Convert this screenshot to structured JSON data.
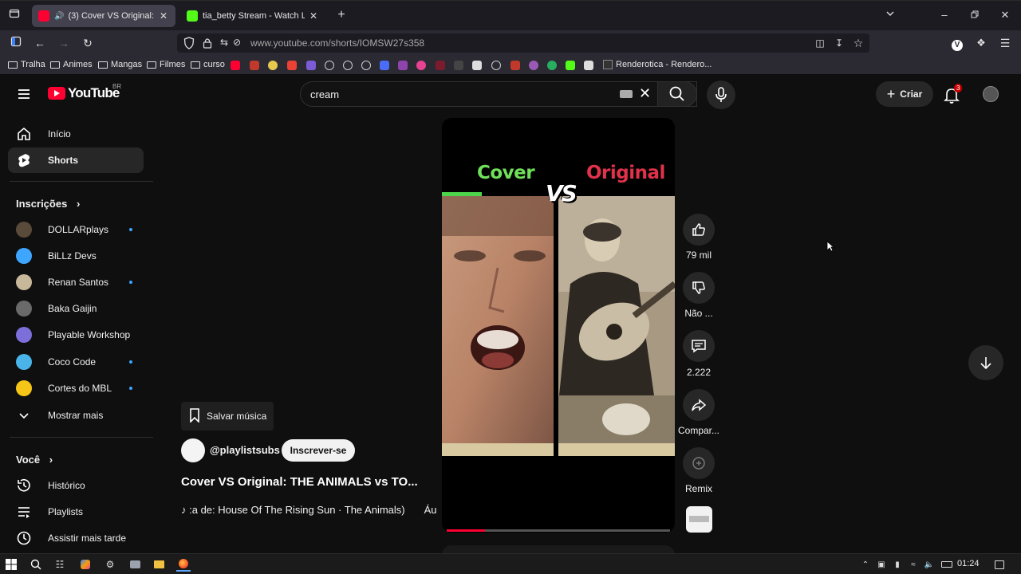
{
  "browser": {
    "tabs": [
      {
        "title": "(3) Cover VS Original: THE ANIMALS vs TO...",
        "active": true
      },
      {
        "title": "tia_betty Stream - Watch Live on Kick",
        "active": false
      }
    ],
    "url": "www.youtube.com/shorts/IOMSW27s358",
    "bookmarks": [
      "Tralha",
      "Animes",
      "Mangas",
      "Filmes",
      "curso",
      "Renderotica - Rendero..."
    ]
  },
  "masthead": {
    "logo_text": "YouTube",
    "country_code": "BR",
    "search_value": "cream",
    "create_label": "Criar",
    "notification_count": "3"
  },
  "sidebar": {
    "primary": [
      {
        "label": "Início",
        "icon": "home-icon"
      },
      {
        "label": "Shorts",
        "icon": "shorts-icon",
        "active": true
      }
    ],
    "subscriptions_heading": "Inscrições",
    "subscriptions": [
      {
        "label": "DOLLARplays",
        "new": true,
        "color": "#5a4a3a"
      },
      {
        "label": "BiLLz Devs",
        "new": false,
        "color": "#3ea6ff"
      },
      {
        "label": "Renan Santos",
        "new": true,
        "color": "#c7b89a"
      },
      {
        "label": "Baka Gaijin",
        "new": false,
        "color": "#6a6a6a"
      },
      {
        "label": "Playable Workshop",
        "new": false,
        "color": "#7c6fd9"
      },
      {
        "label": "Coco Code",
        "new": true,
        "color": "#4ab3e8"
      },
      {
        "label": "Cortes do MBL",
        "new": true,
        "color": "#f5c518"
      }
    ],
    "show_more_label": "Mostrar mais",
    "you_heading": "Você",
    "you_items": [
      {
        "label": "Histórico",
        "icon": "history-icon"
      },
      {
        "label": "Playlists",
        "icon": "playlists-icon"
      },
      {
        "label": "Assistir mais tarde",
        "icon": "watch-later-icon"
      }
    ]
  },
  "short": {
    "video_text_left": "Cover",
    "video_text_vs": "VS",
    "video_text_right": "Original",
    "progress": 0.17,
    "save_music_label": "Salvar música",
    "channel": "@playlistsubs",
    "subscribe_label": "Inscrever-se",
    "title": "Cover VS Original: THE ANIMALS vs TO...",
    "music_line": ":a de: House Of The Rising Sun · The Animals)",
    "music_line_tail": "Áu"
  },
  "actions": {
    "like_count": "79 mil",
    "dislike_label": "Não ...",
    "comments_count": "2.222",
    "share_label": "Compar...",
    "remix_label": "Remix"
  },
  "taskbar": {
    "time": "01:24"
  },
  "colors": {
    "yt_red": "#ff0033",
    "cover_green": "#6fe05a",
    "original_red": "#e0324a",
    "subscription_dot": "#3ea6ff"
  }
}
